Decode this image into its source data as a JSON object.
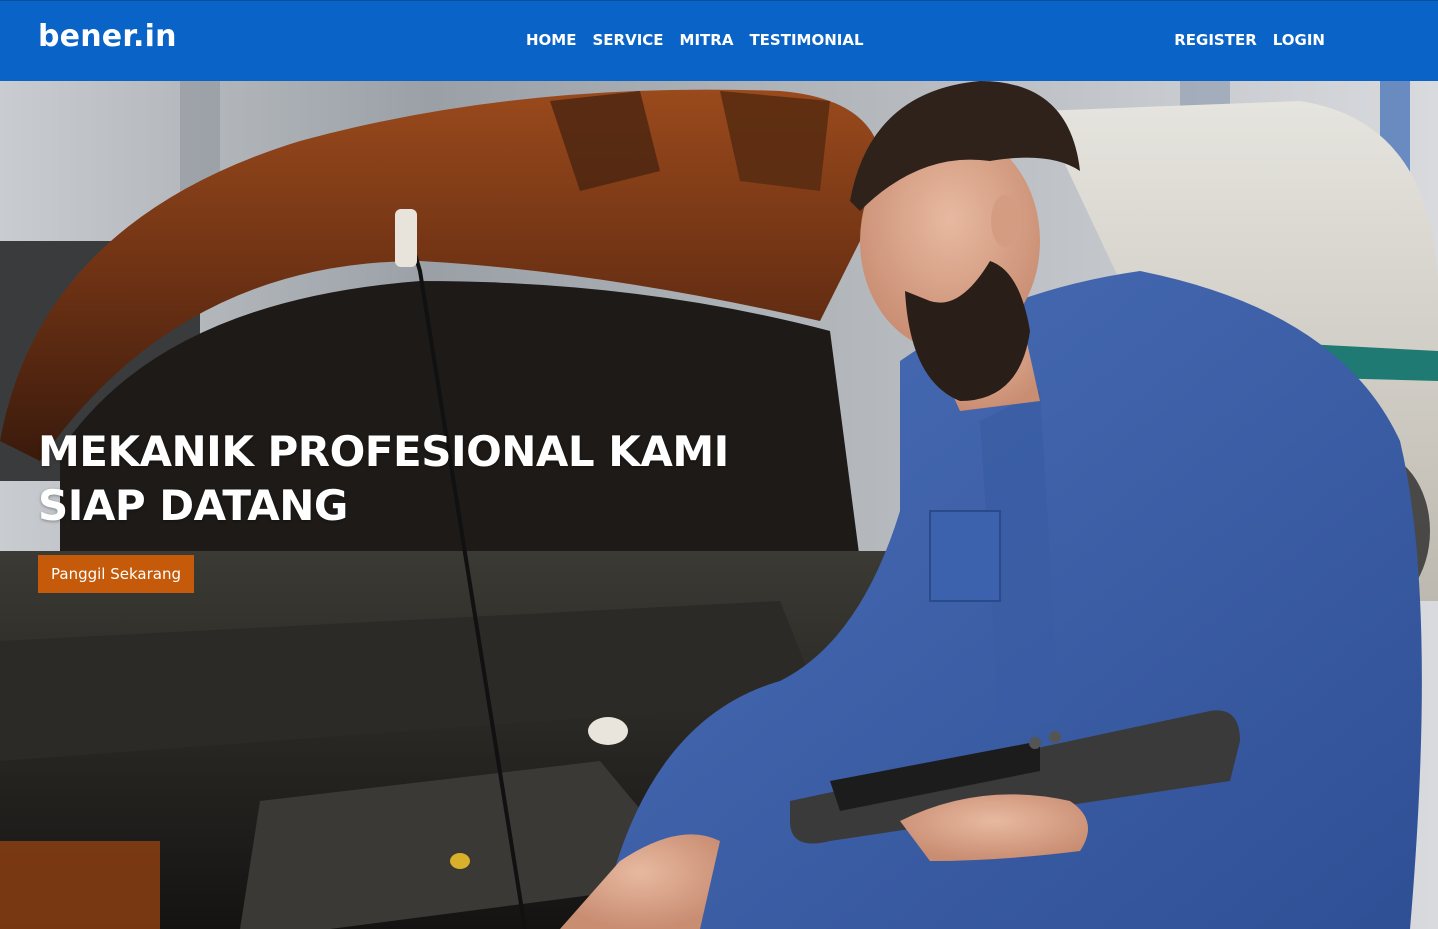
{
  "navbar": {
    "brand": "bener.in",
    "links": [
      "HOME",
      "SERVICE",
      "MITRA",
      "TESTIMONIAL"
    ],
    "auth": [
      "REGISTER",
      "LOGIN"
    ]
  },
  "hero": {
    "title_line1": "MEKANIK PROFESIONAL KAMI",
    "title_line2": "SIAP DATANG",
    "cta_label": "Panggil Sekarang"
  },
  "colors": {
    "navbar": "#0a63c6",
    "cta": "#c45a0a",
    "text": "#ffffff"
  }
}
